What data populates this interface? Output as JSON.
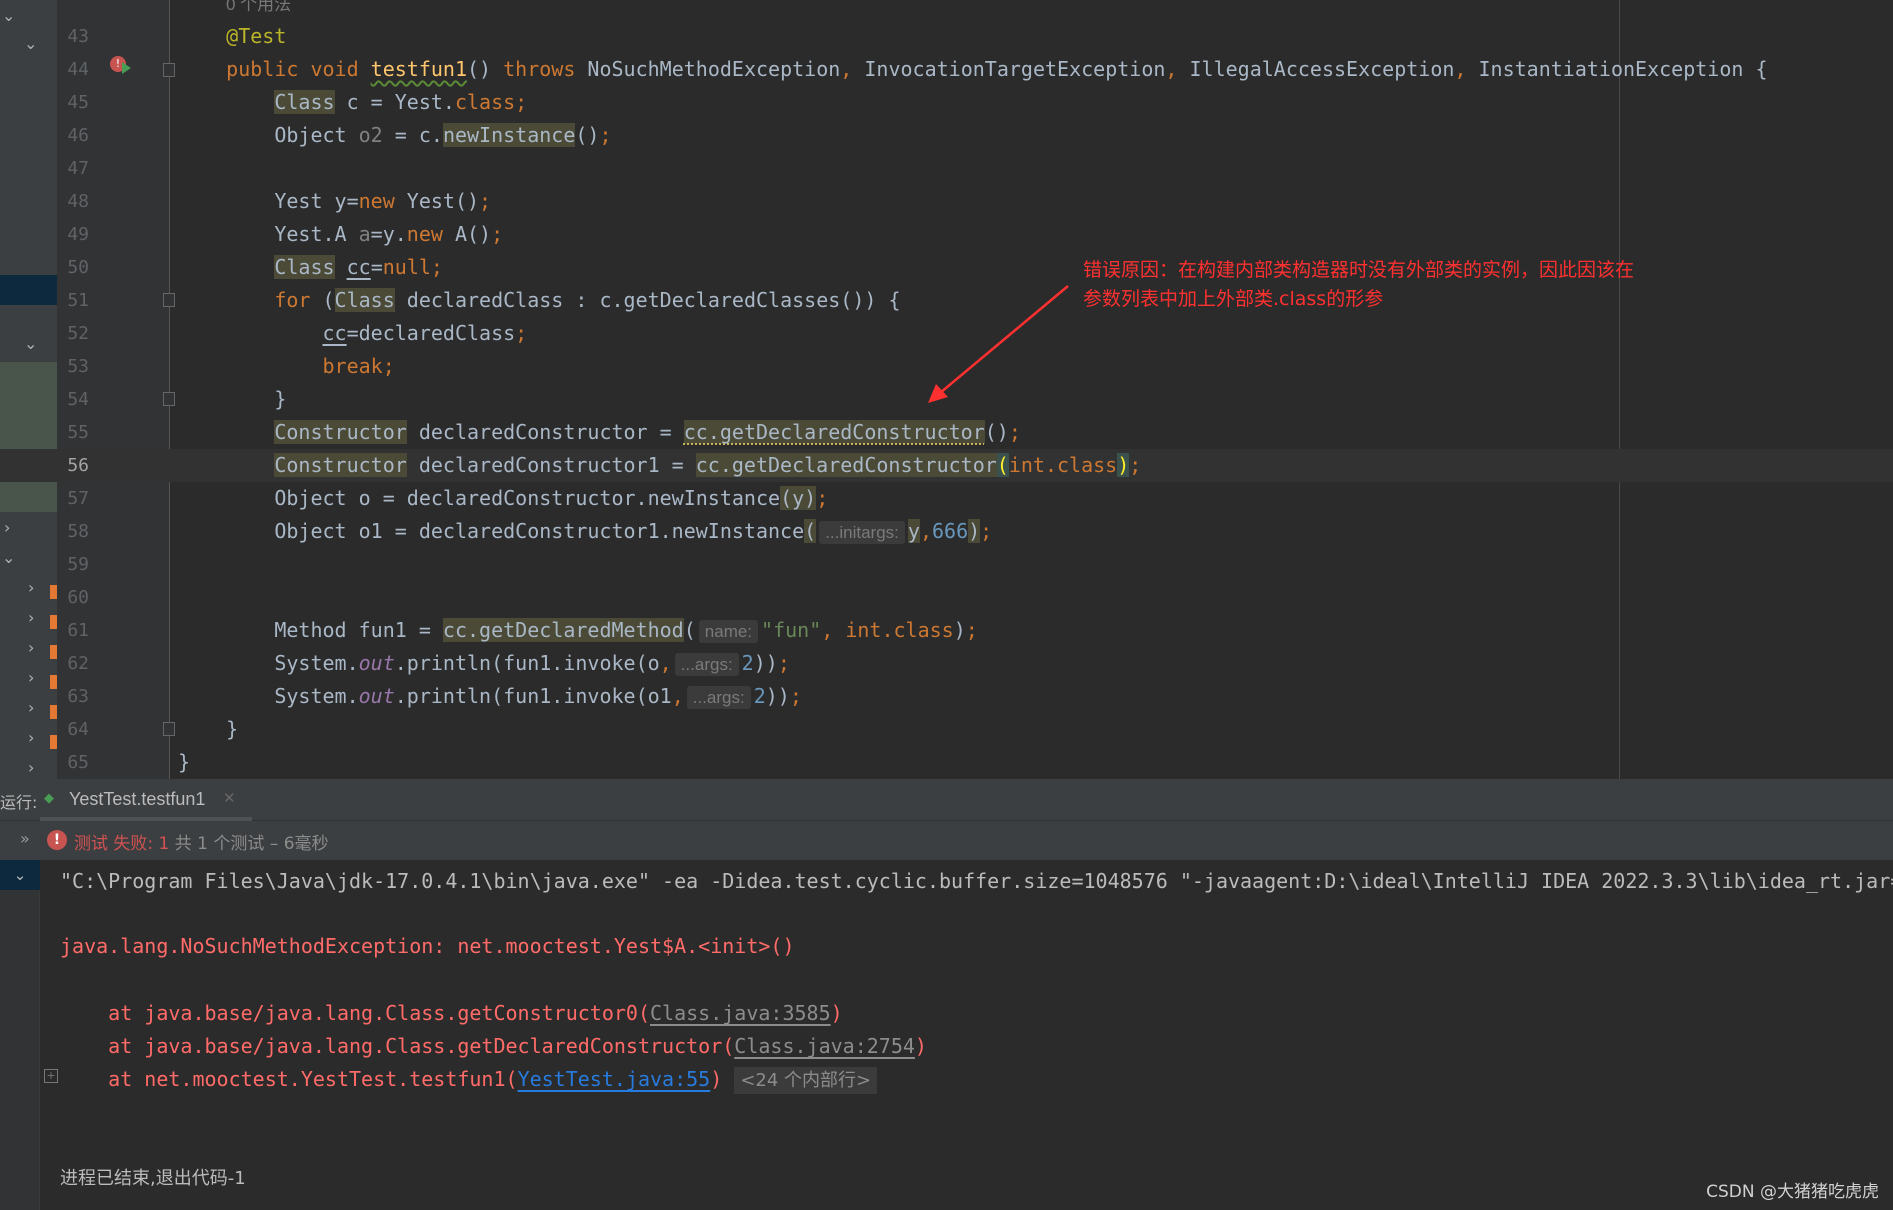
{
  "editor": {
    "usage_hint": "0 个用法",
    "current_line": 56,
    "lines": [
      {
        "n": 43,
        "tokens": [
          {
            "t": "    "
          },
          {
            "t": "@Test",
            "c": "a"
          }
        ]
      },
      {
        "n": 44,
        "tokens": [
          {
            "t": "    "
          },
          {
            "t": "public void ",
            "c": "k"
          },
          {
            "t": "testfun1",
            "c": "f"
          },
          {
            "t": "() "
          },
          {
            "t": "throws ",
            "c": "k"
          },
          {
            "t": "NoSuchMethodException"
          },
          {
            "t": ", ",
            "c": "k"
          },
          {
            "t": "InvocationTargetException"
          },
          {
            "t": ", ",
            "c": "k"
          },
          {
            "t": "IllegalAccessException"
          },
          {
            "t": ", ",
            "c": "k"
          },
          {
            "t": "InstantiationException {"
          }
        ]
      },
      {
        "n": 45,
        "tokens": [
          {
            "t": "        "
          },
          {
            "t": "Class",
            "c": "h"
          },
          {
            "t": " c = Yest."
          },
          {
            "t": "class;",
            "c": "k"
          }
        ]
      },
      {
        "n": 46,
        "tokens": [
          {
            "t": "        Object "
          },
          {
            "t": "o2",
            "c": "g"
          },
          {
            "t": " = c."
          },
          {
            "t": "newInstance",
            "c": "h"
          },
          {
            "t": "()"
          },
          {
            "t": ";",
            "c": "k"
          }
        ]
      },
      {
        "n": 47,
        "tokens": []
      },
      {
        "n": 48,
        "tokens": [
          {
            "t": "        Yest y="
          },
          {
            "t": "new ",
            "c": "k"
          },
          {
            "t": "Yest()"
          },
          {
            "t": ";",
            "c": "k"
          }
        ]
      },
      {
        "n": 49,
        "tokens": [
          {
            "t": "        Yest.A "
          },
          {
            "t": "a",
            "c": "g"
          },
          {
            "t": "=y."
          },
          {
            "t": "new ",
            "c": "k"
          },
          {
            "t": "A()"
          },
          {
            "t": ";",
            "c": "k"
          }
        ]
      },
      {
        "n": 50,
        "tokens": [
          {
            "t": "        "
          },
          {
            "t": "Class",
            "c": "h"
          },
          {
            "t": " "
          },
          {
            "t": "cc",
            "c": "u"
          },
          {
            "t": "="
          },
          {
            "t": "null;",
            "c": "k"
          }
        ]
      },
      {
        "n": 51,
        "tokens": [
          {
            "t": "        "
          },
          {
            "t": "for ",
            "c": "k"
          },
          {
            "t": "("
          },
          {
            "t": "Class",
            "c": "h"
          },
          {
            "t": " declaredClass : c.getDeclaredClasses()) {"
          }
        ]
      },
      {
        "n": 52,
        "tokens": [
          {
            "t": "            "
          },
          {
            "t": "cc",
            "c": "u"
          },
          {
            "t": "=declaredClass"
          },
          {
            "t": ";",
            "c": "k"
          }
        ]
      },
      {
        "n": 53,
        "tokens": [
          {
            "t": "            "
          },
          {
            "t": "break;",
            "c": "k"
          }
        ]
      },
      {
        "n": 54,
        "tokens": [
          {
            "t": "        }"
          }
        ]
      },
      {
        "n": 55,
        "tokens": [
          {
            "t": "        "
          },
          {
            "t": "Constructor",
            "c": "h"
          },
          {
            "t": " declaredConstructor = "
          },
          {
            "t": "cc.getDeclaredConstructor",
            "c": "hu"
          },
          {
            "t": "()"
          },
          {
            "t": ";",
            "c": "k"
          }
        ]
      },
      {
        "n": 56,
        "tokens": [
          {
            "t": "        "
          },
          {
            "t": "Constructor",
            "c": "h"
          },
          {
            "t": " declaredConstructor1 = "
          },
          {
            "t": "cc.getDeclaredConstructor",
            "c": "h"
          },
          {
            "t": "(",
            "c": "pm"
          },
          {
            "t": "int.class",
            "c": "k"
          },
          {
            "t": ")",
            "c": "pm"
          },
          {
            "t": ";",
            "c": "k"
          }
        ]
      },
      {
        "n": 57,
        "tokens": [
          {
            "t": "        Object o = declaredConstructor.newInstance"
          },
          {
            "t": "(y)",
            "c": "h"
          },
          {
            "t": ";",
            "c": "k"
          }
        ]
      },
      {
        "n": 58,
        "tokens": [
          {
            "t": "        Object o1 = declaredConstructor1.newInstance"
          },
          {
            "t": "(",
            "c": "h"
          },
          {
            "t": "...initargs:",
            "c": "hint"
          },
          {
            "t": "y",
            "c": "h"
          },
          {
            "t": ",",
            "c": "k"
          },
          {
            "t": "666",
            "c": "n"
          },
          {
            "t": ")",
            "c": "h"
          },
          {
            "t": ";",
            "c": "k"
          }
        ]
      },
      {
        "n": 59,
        "tokens": []
      },
      {
        "n": 60,
        "tokens": []
      },
      {
        "n": 61,
        "tokens": [
          {
            "t": "        Method fun1 = "
          },
          {
            "t": "cc.getDeclaredMethod",
            "c": "h"
          },
          {
            "t": "("
          },
          {
            "t": "name:",
            "c": "hint"
          },
          {
            "t": "\"fun\"",
            "c": "s"
          },
          {
            "t": ", ",
            "c": "k"
          },
          {
            "t": "int.class",
            "c": "k"
          },
          {
            "t": ")"
          },
          {
            "t": ";",
            "c": "k"
          }
        ]
      },
      {
        "n": 62,
        "tokens": [
          {
            "t": "        System."
          },
          {
            "t": "out",
            "c": "i"
          },
          {
            "t": ".println(fun1.invoke(o"
          },
          {
            "t": ",",
            "c": "k"
          },
          {
            "t": "...args:",
            "c": "hint"
          },
          {
            "t": "2",
            "c": "n"
          },
          {
            "t": "))"
          },
          {
            "t": ";",
            "c": "k"
          }
        ]
      },
      {
        "n": 63,
        "tokens": [
          {
            "t": "        System."
          },
          {
            "t": "out",
            "c": "i"
          },
          {
            "t": ".println(fun1.invoke(o1"
          },
          {
            "t": ",",
            "c": "k"
          },
          {
            "t": "...args:",
            "c": "hint"
          },
          {
            "t": "2",
            "c": "n"
          },
          {
            "t": "))"
          },
          {
            "t": ";",
            "c": "k"
          }
        ]
      },
      {
        "n": 64,
        "tokens": [
          {
            "t": "    }"
          }
        ]
      },
      {
        "n": 65,
        "tokens": [
          {
            "t": "}"
          }
        ]
      }
    ]
  },
  "annotation": {
    "line1": "错误原因：在构建内部类构造器时没有外部类的实例，因此因该在",
    "line2": "参数列表中加上外部类.class的形参",
    "color": "#ff3030"
  },
  "run_panel": {
    "label": "运行:",
    "tab_label": "YestTest.testfun1",
    "status_fail": "测试 失败: 1",
    "status_summary": "共 1 个测试 – 6毫秒",
    "console": {
      "command": "\"C:\\Program Files\\Java\\jdk-17.0.4.1\\bin\\java.exe\" -ea -Didea.test.cyclic.buffer.size=1048576 \"-javaagent:D:\\ideal\\IntelliJ IDEA 2022.3.3\\lib\\idea_rt.jar=",
      "exception": "java.lang.NoSuchMethodException: net.mooctest.Yest$A.<init>()",
      "stack": [
        {
          "prefix": "    at java.base/java.lang.Class.getConstructor0(",
          "link": "Class.java:3585",
          "suffix": ")"
        },
        {
          "prefix": "    at java.base/java.lang.Class.getDeclaredConstructor(",
          "link": "Class.java:2754",
          "suffix": ")"
        },
        {
          "prefix": "    at net.mooctest.YestTest.testfun1(",
          "link": "YestTest.java:55",
          "suffix": ")",
          "folded": "<24 个内部行>"
        }
      ],
      "exit": "进程已结束,退出代码-1"
    }
  },
  "watermark": "CSDN @大猪猪吃虎虎"
}
